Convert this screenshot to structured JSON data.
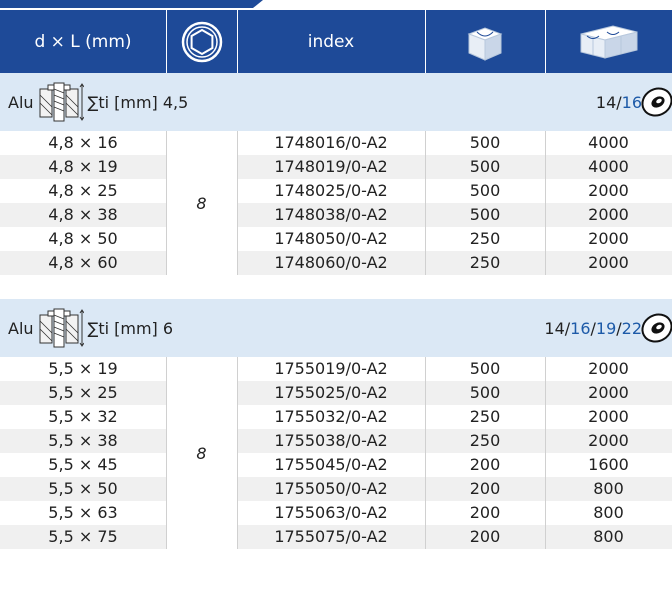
{
  "header": {
    "col_size": "d × L (mm)",
    "col_index": "index"
  },
  "sections": [
    {
      "material": "Alu",
      "sum_label": "∑ti [mm] 4,5",
      "range_parts": [
        "14/",
        "16"
      ],
      "pack": "8",
      "rows": [
        {
          "size": "4,8 × 16",
          "index": "1748016/0-A2",
          "box": "500",
          "carton": "4000"
        },
        {
          "size": "4,8 × 19",
          "index": "1748019/0-A2",
          "box": "500",
          "carton": "4000"
        },
        {
          "size": "4,8 × 25",
          "index": "1748025/0-A2",
          "box": "500",
          "carton": "2000"
        },
        {
          "size": "4,8 × 38",
          "index": "1748038/0-A2",
          "box": "500",
          "carton": "2000"
        },
        {
          "size": "4,8 × 50",
          "index": "1748050/0-A2",
          "box": "250",
          "carton": "2000"
        },
        {
          "size": "4,8 × 60",
          "index": "1748060/0-A2",
          "box": "250",
          "carton": "2000"
        }
      ]
    },
    {
      "material": "Alu",
      "sum_label": "∑ti [mm] 6",
      "range_parts": [
        "14/",
        "16",
        "/",
        "19",
        "/",
        "22"
      ],
      "pack": "8",
      "rows": [
        {
          "size": "5,5 × 19",
          "index": "1755019/0-A2",
          "box": "500",
          "carton": "2000"
        },
        {
          "size": "5,5 × 25",
          "index": "1755025/0-A2",
          "box": "500",
          "carton": "2000"
        },
        {
          "size": "5,5 × 32",
          "index": "1755032/0-A2",
          "box": "250",
          "carton": "2000"
        },
        {
          "size": "5,5 × 38",
          "index": "1755038/0-A2",
          "box": "250",
          "carton": "2000"
        },
        {
          "size": "5,5 × 45",
          "index": "1755045/0-A2",
          "box": "200",
          "carton": "1600"
        },
        {
          "size": "5,5 × 50",
          "index": "1755050/0-A2",
          "box": "200",
          "carton": "800"
        },
        {
          "size": "5,5 × 63",
          "index": "1755063/0-A2",
          "box": "200",
          "carton": "800"
        },
        {
          "size": "5,5 × 75",
          "index": "1755075/0-A2",
          "box": "200",
          "carton": "800"
        }
      ]
    }
  ],
  "icons": {
    "pack_col": "hexagon-nut-icon",
    "box_col": "small-box-icon",
    "carton_col": "carton-icon",
    "rivet": "blind-rivet-icon",
    "washer": "washer-icon"
  },
  "colors": {
    "header_bg": "#1e4a98",
    "section_bg": "#dbe8f5",
    "row_shade": "#f0f0f0",
    "accent_text": "#1d5aa8"
  }
}
